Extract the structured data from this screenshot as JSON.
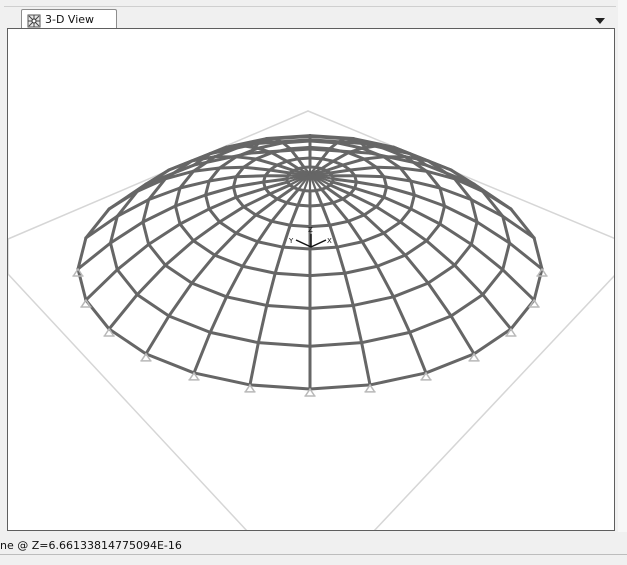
{
  "window": {
    "tab_label": "3-D View",
    "tab_icon": "structure-3d-icon",
    "dropdown_icon": "chevron-down-icon"
  },
  "view": {
    "grid_color": "#d6d6d6",
    "frame_color": "#666666",
    "support_color": "#b8b8b8",
    "axis_labels": {
      "x": "X",
      "y": "Y",
      "z": "Z"
    }
  },
  "status": {
    "text": "ne @ Z=6.66133814775094E-16"
  }
}
